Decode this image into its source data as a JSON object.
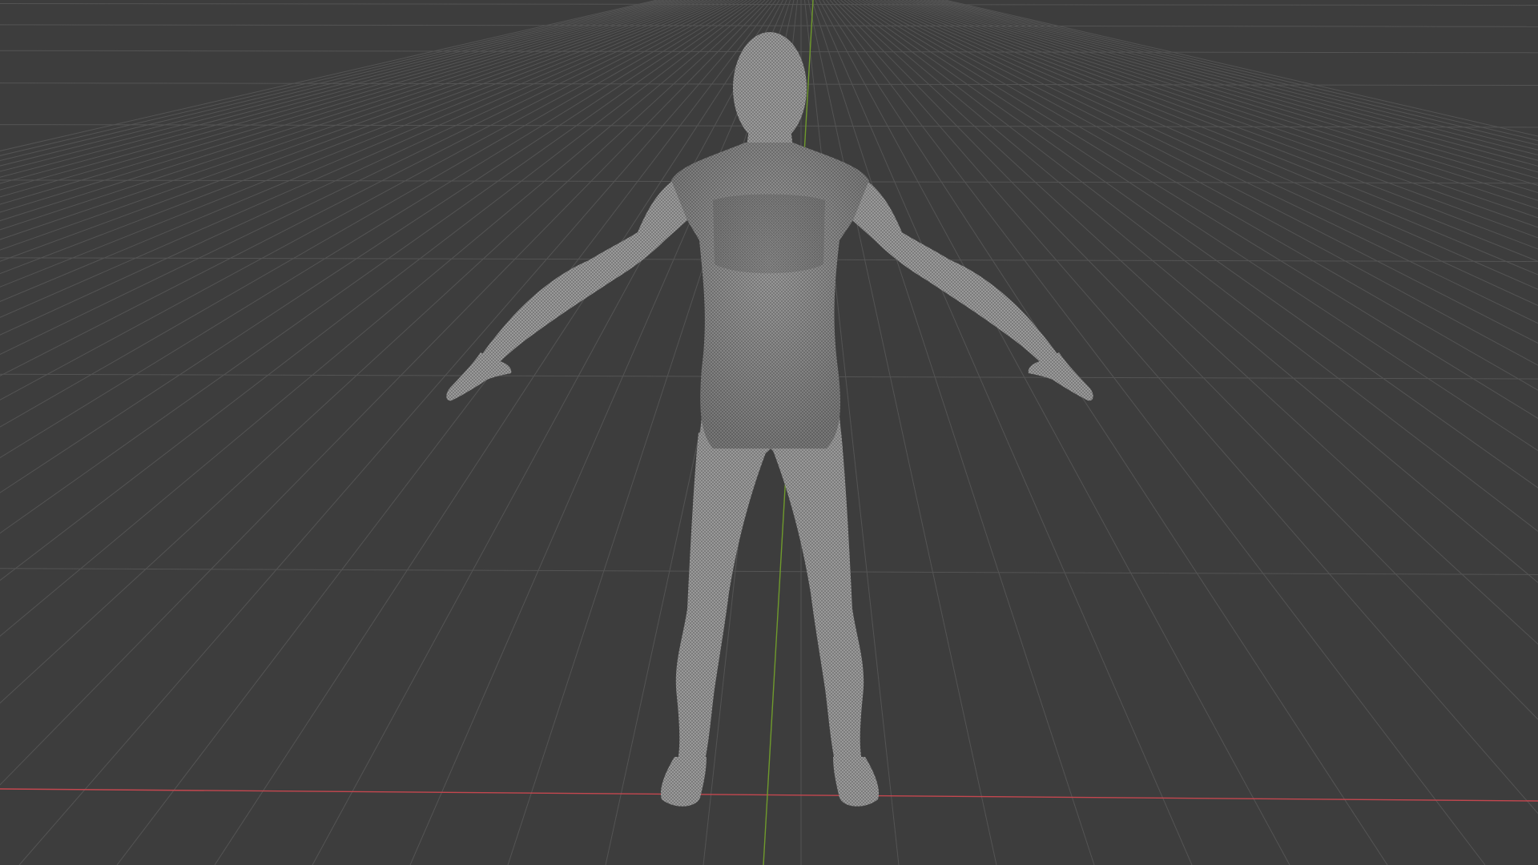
{
  "viewport": {
    "view": "3d-viewport",
    "shading": "wireframe-overlay",
    "background_color": "#3d3d3d",
    "grid_color": "#545454",
    "x_axis_color": "#c4474f",
    "y_axis_color": "#6f9a2c"
  },
  "scene": {
    "object": "humanoid-mesh",
    "pose": "A-pose",
    "mesh_color": "#9e9e9e",
    "wire_color": "#6e6e6e"
  }
}
